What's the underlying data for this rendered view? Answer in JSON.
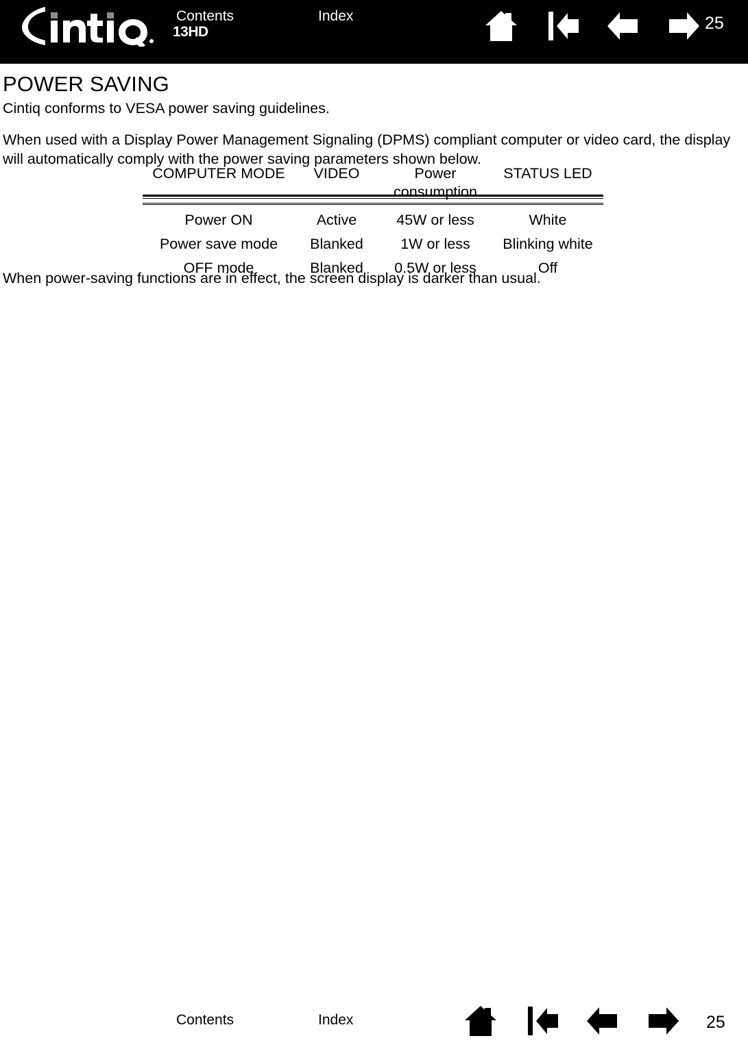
{
  "document": {
    "product_logo_text": "Cintiq",
    "product_logo_suffix": "13HD",
    "page_number": "25"
  },
  "header": {
    "contents_label": "Contents",
    "index_label": "Index",
    "page_number": "25",
    "icons": [
      {
        "name": "home-icon",
        "label": "Home"
      },
      {
        "name": "first-page-icon",
        "label": "First page"
      },
      {
        "name": "previous-page-icon",
        "label": "Previous page"
      },
      {
        "name": "next-page-icon",
        "label": "Next page"
      }
    ]
  },
  "main": {
    "title": "POWER SAVING",
    "intro": "Cintiq conforms to VESA power saving guidelines.",
    "description": "When used with a Display Power Management Signaling (DPMS) compliant computer or video card, the display will automatically comply with the power saving parameters shown below.",
    "closing": "When power-saving functions are in effect, the screen display is darker than usual.",
    "table": {
      "headers": [
        "COMPUTER MODE",
        "VIDEO",
        "Power consumption",
        "STATUS LED"
      ],
      "rows": [
        {
          "mode": "Power ON",
          "video": "Active",
          "power": "45W or less",
          "led": "White"
        },
        {
          "mode": "Power save mode",
          "video": "Blanked",
          "power": "1W or less",
          "led": "Blinking white"
        },
        {
          "mode": "OFF mode",
          "video": "Blanked",
          "power": "0.5W or less",
          "led": "Off"
        }
      ]
    }
  },
  "footer": {
    "contents_label": "Contents",
    "index_label": "Index",
    "page_number": "25",
    "icons": [
      {
        "name": "home-icon",
        "label": "Home"
      },
      {
        "name": "first-page-icon",
        "label": "First page"
      },
      {
        "name": "previous-page-icon",
        "label": "Previous page"
      },
      {
        "name": "next-page-icon",
        "label": "Next page"
      }
    ]
  },
  "colors": {
    "header_background": "#000000",
    "header_foreground": "#ffffff",
    "page_background": "#ffffff",
    "text": "#000000"
  }
}
